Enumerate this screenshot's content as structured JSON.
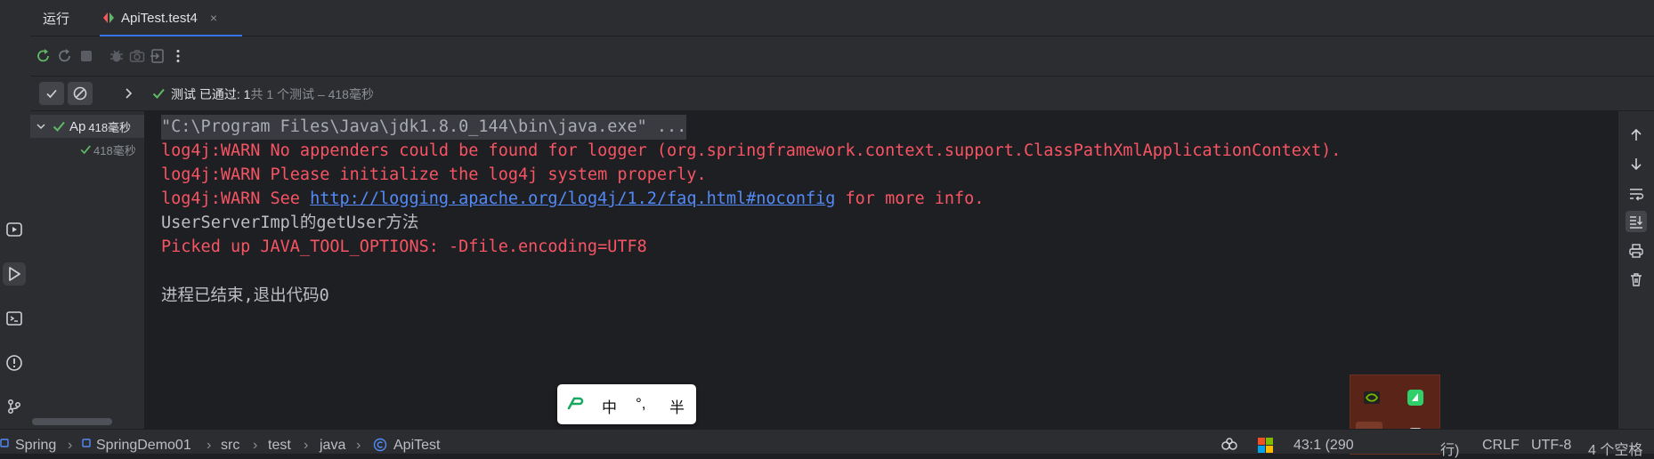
{
  "colors": {
    "accent": "#3574f0",
    "pass_green": "#5fb865",
    "error_red": "#f75464",
    "link_blue": "#548af7",
    "panel_bg": "#2b2d30",
    "console_bg": "#1e1f22"
  },
  "tabbar": {
    "run_title": "运行",
    "tab_label": "ApiTest.test4",
    "tab_close": "×"
  },
  "toolbar": {
    "icons": [
      "rerun-icon",
      "rerun-failed-icon",
      "stop-icon",
      "debug-icon",
      "camera-icon",
      "exit-icon",
      "more-icon"
    ]
  },
  "status": {
    "prefix": "测试 已通过: 1",
    "suffix": "共 1 个测试 – 418毫秒"
  },
  "tree": {
    "root_label": "Ap",
    "root_time": "418毫秒",
    "child_time": "418毫秒"
  },
  "console": {
    "cmd": "\"C:\\Program Files\\Java\\jdk1.8.0_144\\bin\\java.exe\" ...",
    "warn1": "log4j:WARN No appenders could be found for logger (org.springframework.context.support.ClassPathXmlApplicationContext).",
    "warn2": "log4j:WARN Please initialize the log4j system properly.",
    "warn3_prefix": "log4j:WARN See ",
    "warn3_link": "http://logging.apache.org/log4j/1.2/faq.html#noconfig",
    "warn3_suffix": " for more info.",
    "out1": "UserServerImpl的getUser方法",
    "picked": "Picked up JAVA_TOOL_OPTIONS: -Dfile.encoding=UTF8",
    "exit": "进程已结束,退出代码0"
  },
  "ime": {
    "mode": "中",
    "punct": "°,",
    "width": "半"
  },
  "statusbar": {
    "project": "Spring",
    "module": "SpringDemo01",
    "path": [
      "src",
      "test",
      "java"
    ],
    "class_name": "ApiTest",
    "position": "43:1 (290",
    "position_tail": "行)",
    "line_sep": "CRLF",
    "encoding": "UTF-8",
    "indent": "4 个空格"
  }
}
